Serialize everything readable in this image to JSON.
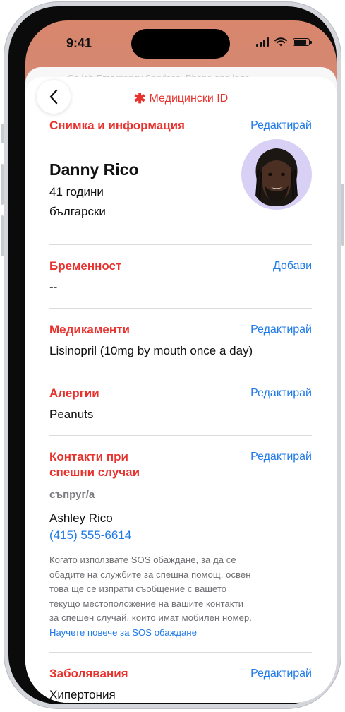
{
  "status_bar": {
    "time": "9:41"
  },
  "nav": {
    "back_icon": "chevron-left-icon",
    "star": "✱",
    "title": "Медицински ID"
  },
  "background_sheet": {
    "ghost_text": "Sa ieb Emergency Services. Phone and lega"
  },
  "photo_info": {
    "title": "Снимка и информация",
    "edit_label": "Редактирай",
    "name": "Danny Rico",
    "age": "41 години",
    "language": "български"
  },
  "pregnancy": {
    "title": "Бременност",
    "add_label": "Добави",
    "value": "--"
  },
  "medications": {
    "title": "Медикаменти",
    "edit_label": "Редактирай",
    "value": "Lisinopril (10mg by mouth once a day)"
  },
  "allergies": {
    "title": "Алергии",
    "edit_label": "Редактирай",
    "value": "Peanuts"
  },
  "emergency_contacts": {
    "title_line1": "Контакти при",
    "title_line2": "спешни случаи",
    "edit_label": "Редактирай",
    "relation": "съпруг/а",
    "contact_name": "Ashley Rico",
    "phone": "(415) 555-6614",
    "note_lines": [
      "Когато използвате SOS обаждане, за да се",
      "обадите на службите за спешна помощ, освен",
      "това ще се изпрати съобщение с вашето",
      "текущо местоположение на вашите контакти",
      "за спешен случай, които имат мобилен номер."
    ],
    "learn_more": "Научете повече за SOS обаждане"
  },
  "conditions": {
    "title": "Заболявания",
    "edit_label": "Редактирай",
    "value": "Хипертония"
  },
  "colors": {
    "accent_red": "#e8322e",
    "link_blue": "#1f7ae8",
    "avatar_bg": "#d9d1f5"
  }
}
